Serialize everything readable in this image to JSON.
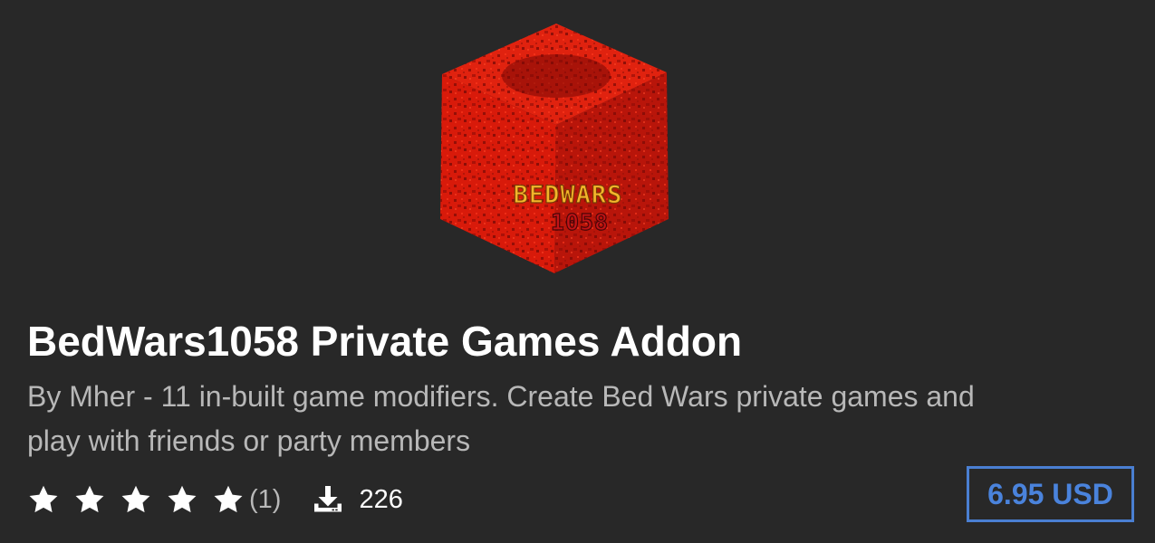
{
  "addon": {
    "image": {
      "name": "bedwars-cube-icon",
      "logo_line1": "BEDWARS",
      "logo_line2": "1058"
    },
    "title": "BedWars1058 Private Games Addon",
    "description": "By Mher - 11 in-built game modifiers. Create Bed Wars private games and play with friends or party members",
    "rating": {
      "stars": 5,
      "max_stars": 5,
      "count_label": "(1)"
    },
    "downloads": {
      "icon": "download-icon",
      "count": "226"
    },
    "price": "6.95 USD"
  },
  "colors": {
    "background": "#282828",
    "title": "#ffffff",
    "description": "#b8b8b8",
    "price_accent": "#4a83dc",
    "cube_red": "#d91a0b"
  }
}
